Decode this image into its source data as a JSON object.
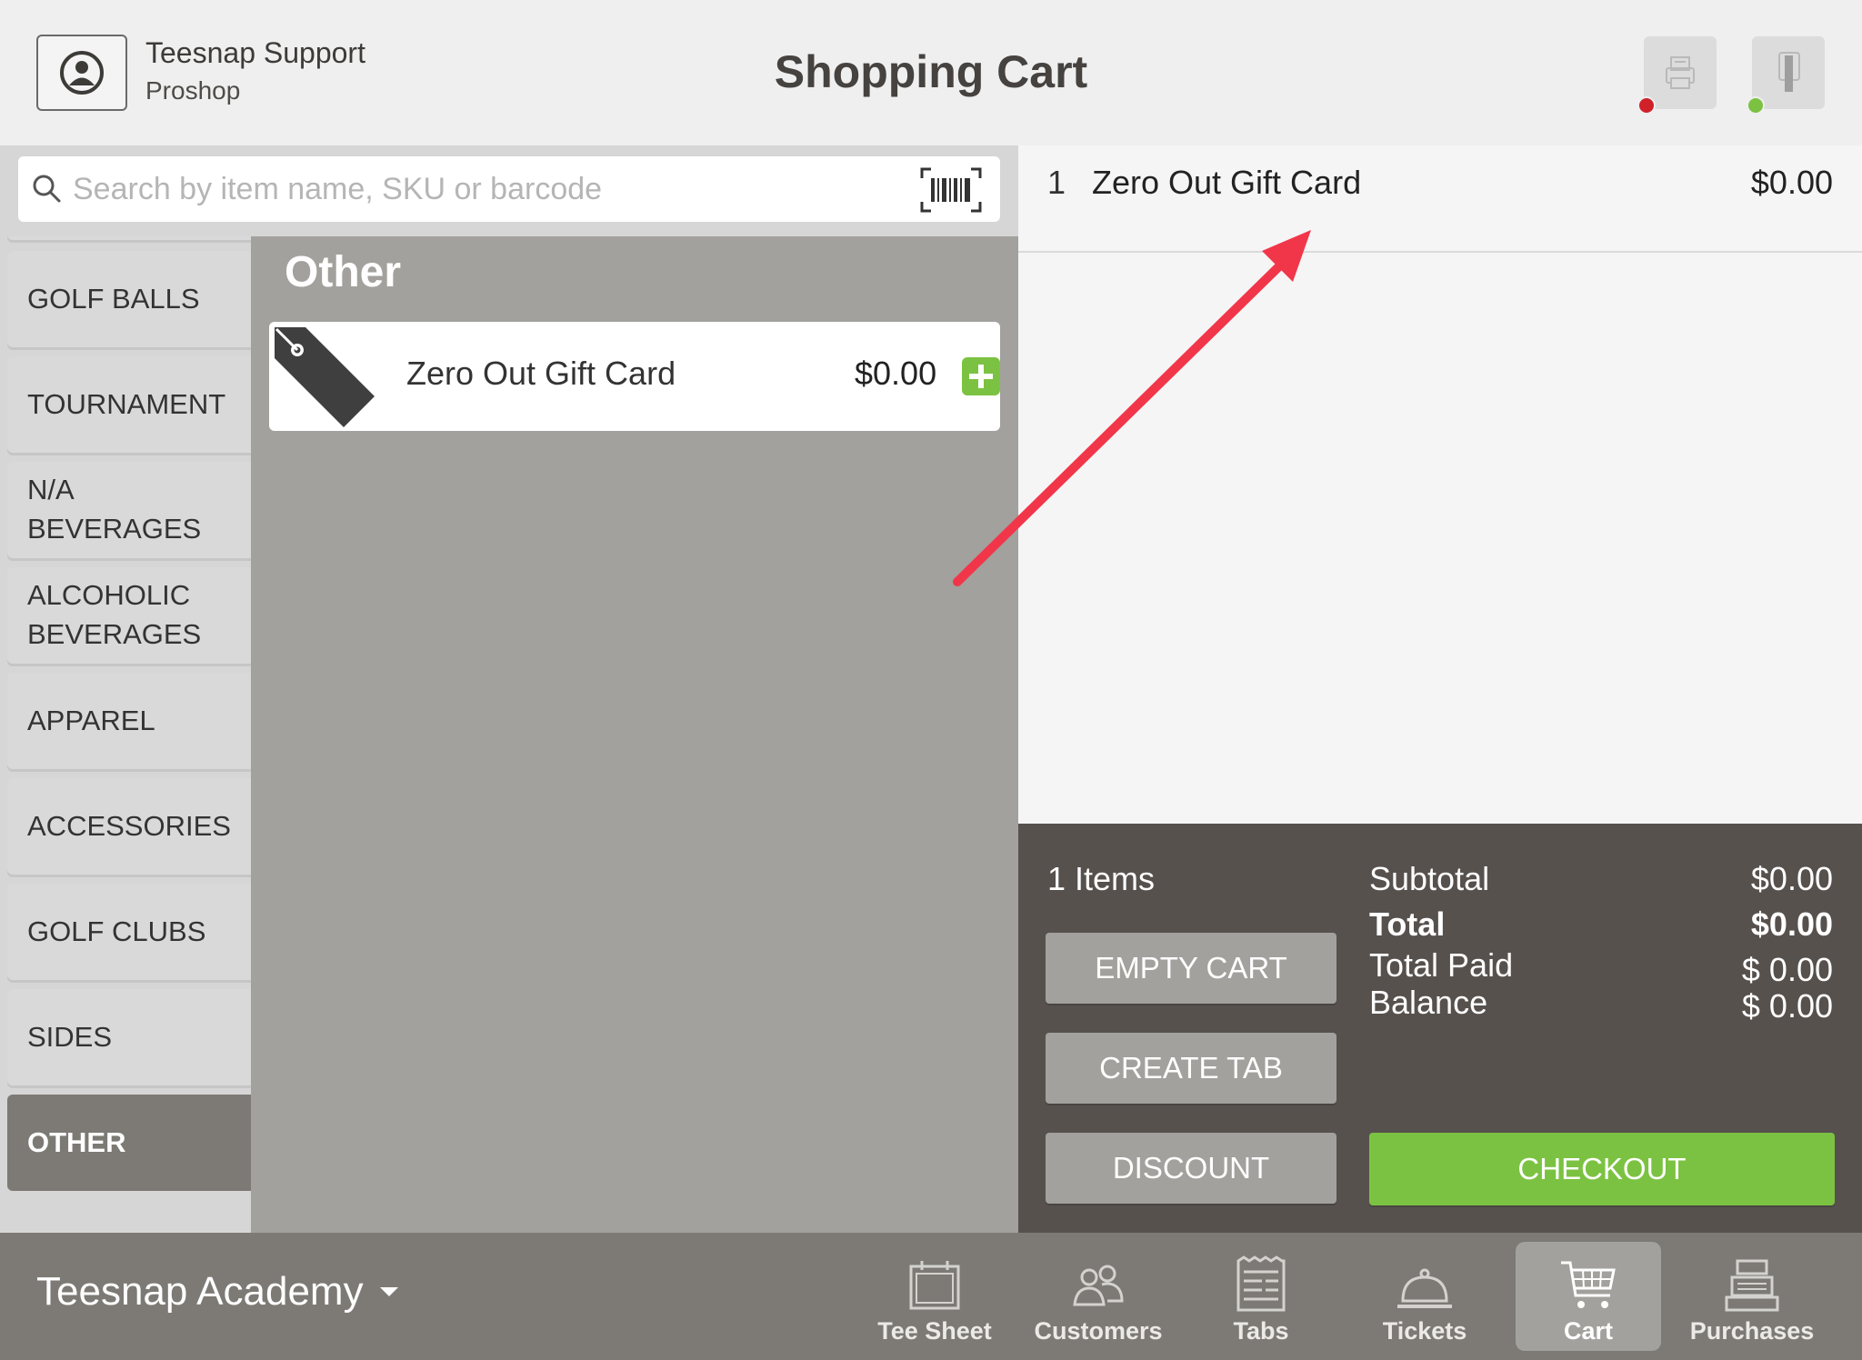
{
  "header": {
    "user_name": "Teesnap Support",
    "user_role": "Proshop",
    "title": "Shopping Cart",
    "printer_status_color": "#d0202a",
    "card_reader_status_color": "#7cc242"
  },
  "search": {
    "placeholder": "Search by item name, SKU or barcode",
    "value": ""
  },
  "categories": [
    {
      "label": "GOLF BALLS",
      "active": false
    },
    {
      "label": "TOURNAMENT",
      "active": false
    },
    {
      "label": "N/A BEVERAGES",
      "active": false
    },
    {
      "label": "ALCOHOLIC BEVERAGES",
      "active": false
    },
    {
      "label": "APPAREL",
      "active": false
    },
    {
      "label": "ACCESSORIES",
      "active": false
    },
    {
      "label": "GOLF CLUBS",
      "active": false
    },
    {
      "label": "SIDES",
      "active": false
    },
    {
      "label": "OTHER",
      "active": true
    }
  ],
  "products": {
    "section_title": "Other",
    "items": [
      {
        "name": "Zero Out Gift Card",
        "price": "$0.00",
        "icon": "price-tag-icon"
      }
    ]
  },
  "cart": {
    "items": [
      {
        "qty": "1",
        "name": "Zero Out Gift Card",
        "price": "$0.00"
      }
    ],
    "items_count": "1 Items",
    "subtotal_label": "Subtotal",
    "subtotal": "$0.00",
    "total_label": "Total",
    "total": "$0.00",
    "total_paid_label": "Total Paid",
    "total_paid": "$ 0.00",
    "balance_label": "Balance",
    "balance": "$ 0.00",
    "buttons": {
      "empty_cart": "EMPTY CART",
      "create_tab": "CREATE TAB",
      "discount": "DISCOUNT",
      "checkout": "CHECKOUT"
    }
  },
  "footer": {
    "location": "Teesnap Academy",
    "tabs": [
      {
        "label": "Tee Sheet",
        "icon": "calendar-icon",
        "active": false
      },
      {
        "label": "Customers",
        "icon": "people-icon",
        "active": false
      },
      {
        "label": "Tabs",
        "icon": "receipt-icon",
        "active": false
      },
      {
        "label": "Tickets",
        "icon": "service-bell-icon",
        "active": false
      },
      {
        "label": "Cart",
        "icon": "cart-icon",
        "active": true
      },
      {
        "label": "Purchases",
        "icon": "cash-register-icon",
        "active": false
      }
    ]
  },
  "colors": {
    "accent_green": "#7cc242",
    "panel_gray": "#a2a19d",
    "summary_dark": "#57514e",
    "tabbar": "#7d7a75",
    "annotation_arrow": "#f2364a"
  }
}
